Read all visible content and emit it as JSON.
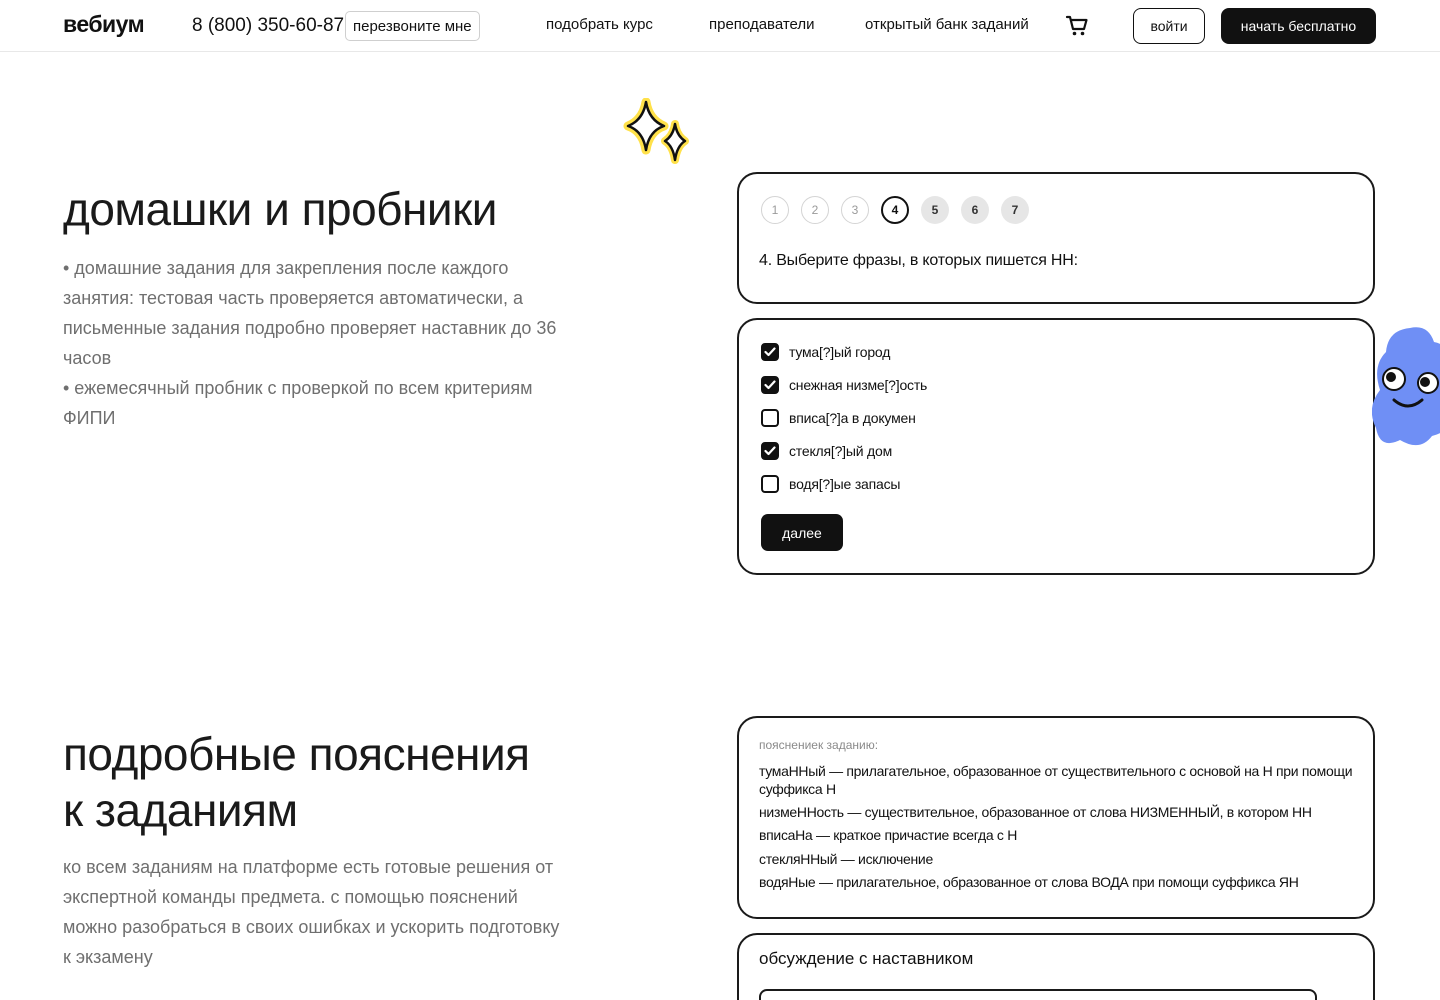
{
  "header": {
    "logo": "вебиум",
    "phone": "8 (800) 350-60-87",
    "callback_label": "перезвоните мне",
    "nav": [
      "подобрать курс",
      "преподаватели",
      "открытый банк заданий"
    ],
    "login_label": "войти",
    "start_label": "начать бесплатно"
  },
  "section1": {
    "title": "домашки и пробники",
    "bullets": [
      "• домашние задания для закрепления после каждого занятия: тестовая часть проверяется автоматически, а письменные задания подробно проверяет наставник до 36 часов",
      "• ежемесячный пробник с проверкой по всем критериям ФИПИ"
    ]
  },
  "quiz": {
    "steps": [
      "1",
      "2",
      "3",
      "4",
      "5",
      "6",
      "7"
    ],
    "current_step": 4,
    "question": "4. Выберите фразы, в которых пишется НН:",
    "options": [
      {
        "label": "тума[?]ый город",
        "checked": true
      },
      {
        "label": "снежная низме[?]ость",
        "checked": true
      },
      {
        "label": "вписа[?]а в докумен",
        "checked": false
      },
      {
        "label": "стекля[?]ый дом",
        "checked": true
      },
      {
        "label": "водя[?]ые запасы",
        "checked": false
      }
    ],
    "next_label": "далее"
  },
  "section2": {
    "title_line1": "подробные пояснения",
    "title_line2": "к заданиям",
    "text": "ко всем заданиям на платформе есть готовые решения от экспертной команды предмета. с помощью пояснений можно разобраться в своих ошибках и ускорить подготовку к экзамену"
  },
  "explanation": {
    "heading": "пояснениек заданию:",
    "lines": [
      "тумаННый — прилагательное, образованное от существительного с основой на Н при помощи суффикса Н",
      "низмеННость — существительное, образованное от слова НИЗМЕННЫЙ, в котором НН",
      "вписаНа — краткое причастие всегда с Н",
      "стекляННый — исключение",
      "водяНые — прилагательное, образованное от слова ВОДА при помощи суффикса ЯН"
    ]
  },
  "discussion": {
    "title": "обсуждение с наставником"
  },
  "colors": {
    "accent_yellow": "#ffe14a",
    "mascot_blue": "#6f8ff5",
    "dark": "#111111",
    "muted_text": "#6f6f6f"
  },
  "icons": [
    "cart-icon",
    "sparkle-icon",
    "checkmark-icon",
    "mascot-blob"
  ]
}
